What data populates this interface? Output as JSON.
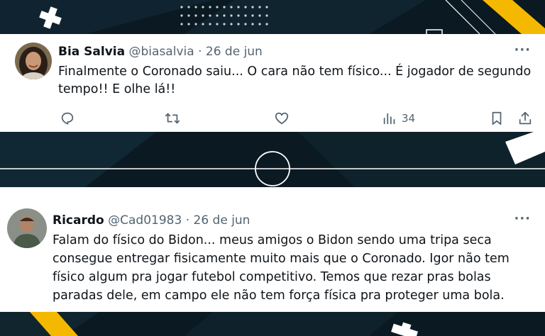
{
  "tweets": [
    {
      "name": "Bia Salvia",
      "handle": "@biasalvia",
      "separator": "·",
      "date": "26 de jun",
      "more": "···",
      "text": "Finalmente o Coronado saiu... O cara não tem físico... É jogador de segundo tempo!! E olhe lá!!",
      "views": "34"
    },
    {
      "name": "Ricardo",
      "handle": "@Cad01983",
      "separator": "·",
      "date": "26 de jun",
      "more": "···",
      "text": "Falam do físico do Bidon... meus amigos o Bidon sendo uma tripa seca consegue entregar fisicamente muito mais que o Coronado. Igor não tem físico algum pra jogar futebol competitivo. Temos que rezar pras bolas paradas dele, em campo ele não tem força física pra proteger uma bola."
    }
  ],
  "icons": [
    "reply-icon",
    "retweet-icon",
    "like-icon",
    "views-icon",
    "bookmark-icon",
    "share-icon"
  ],
  "colors": {
    "background": "#0b1a22",
    "accent": "#f5b800",
    "text": "#0f1419",
    "muted": "#536471"
  }
}
